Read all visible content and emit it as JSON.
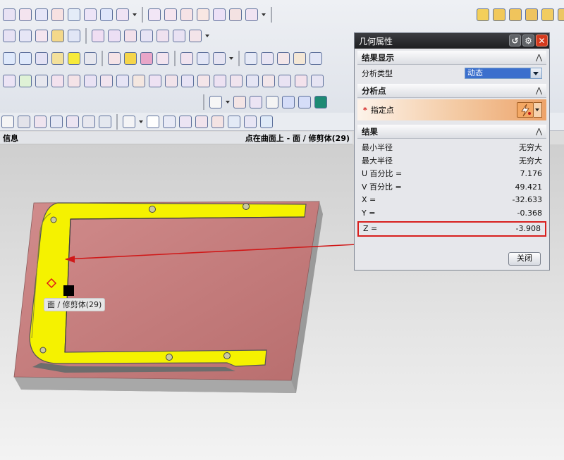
{
  "colors": {
    "part_face": "#c47f7f",
    "highlight": "#f5f200",
    "accent_red": "#d8201e"
  },
  "info_bar": {
    "left": "信息",
    "right": "点在曲面上 - 面 / 修剪体(29)"
  },
  "tooltip": "面 / 修剪体(29)",
  "dialog": {
    "title": "几何属性",
    "section_display": "结果显示",
    "analysis_type_label": "分析类型",
    "analysis_type_value": "动态",
    "section_point": "分析点",
    "point_label": "指定点",
    "section_result": "结果",
    "results": [
      {
        "label": "最小半径",
        "value": "无穷大"
      },
      {
        "label": "最大半径",
        "value": "无穷大"
      },
      {
        "label": "U 百分比 =",
        "value": "7.176"
      },
      {
        "label": "V 百分比 =",
        "value": "49.421"
      },
      {
        "label": "X =",
        "value": "-32.633"
      },
      {
        "label": "Y =",
        "value": "-0.368"
      }
    ],
    "z_label": "Z =",
    "z_value": "-3.908",
    "close_label": "关闭"
  }
}
